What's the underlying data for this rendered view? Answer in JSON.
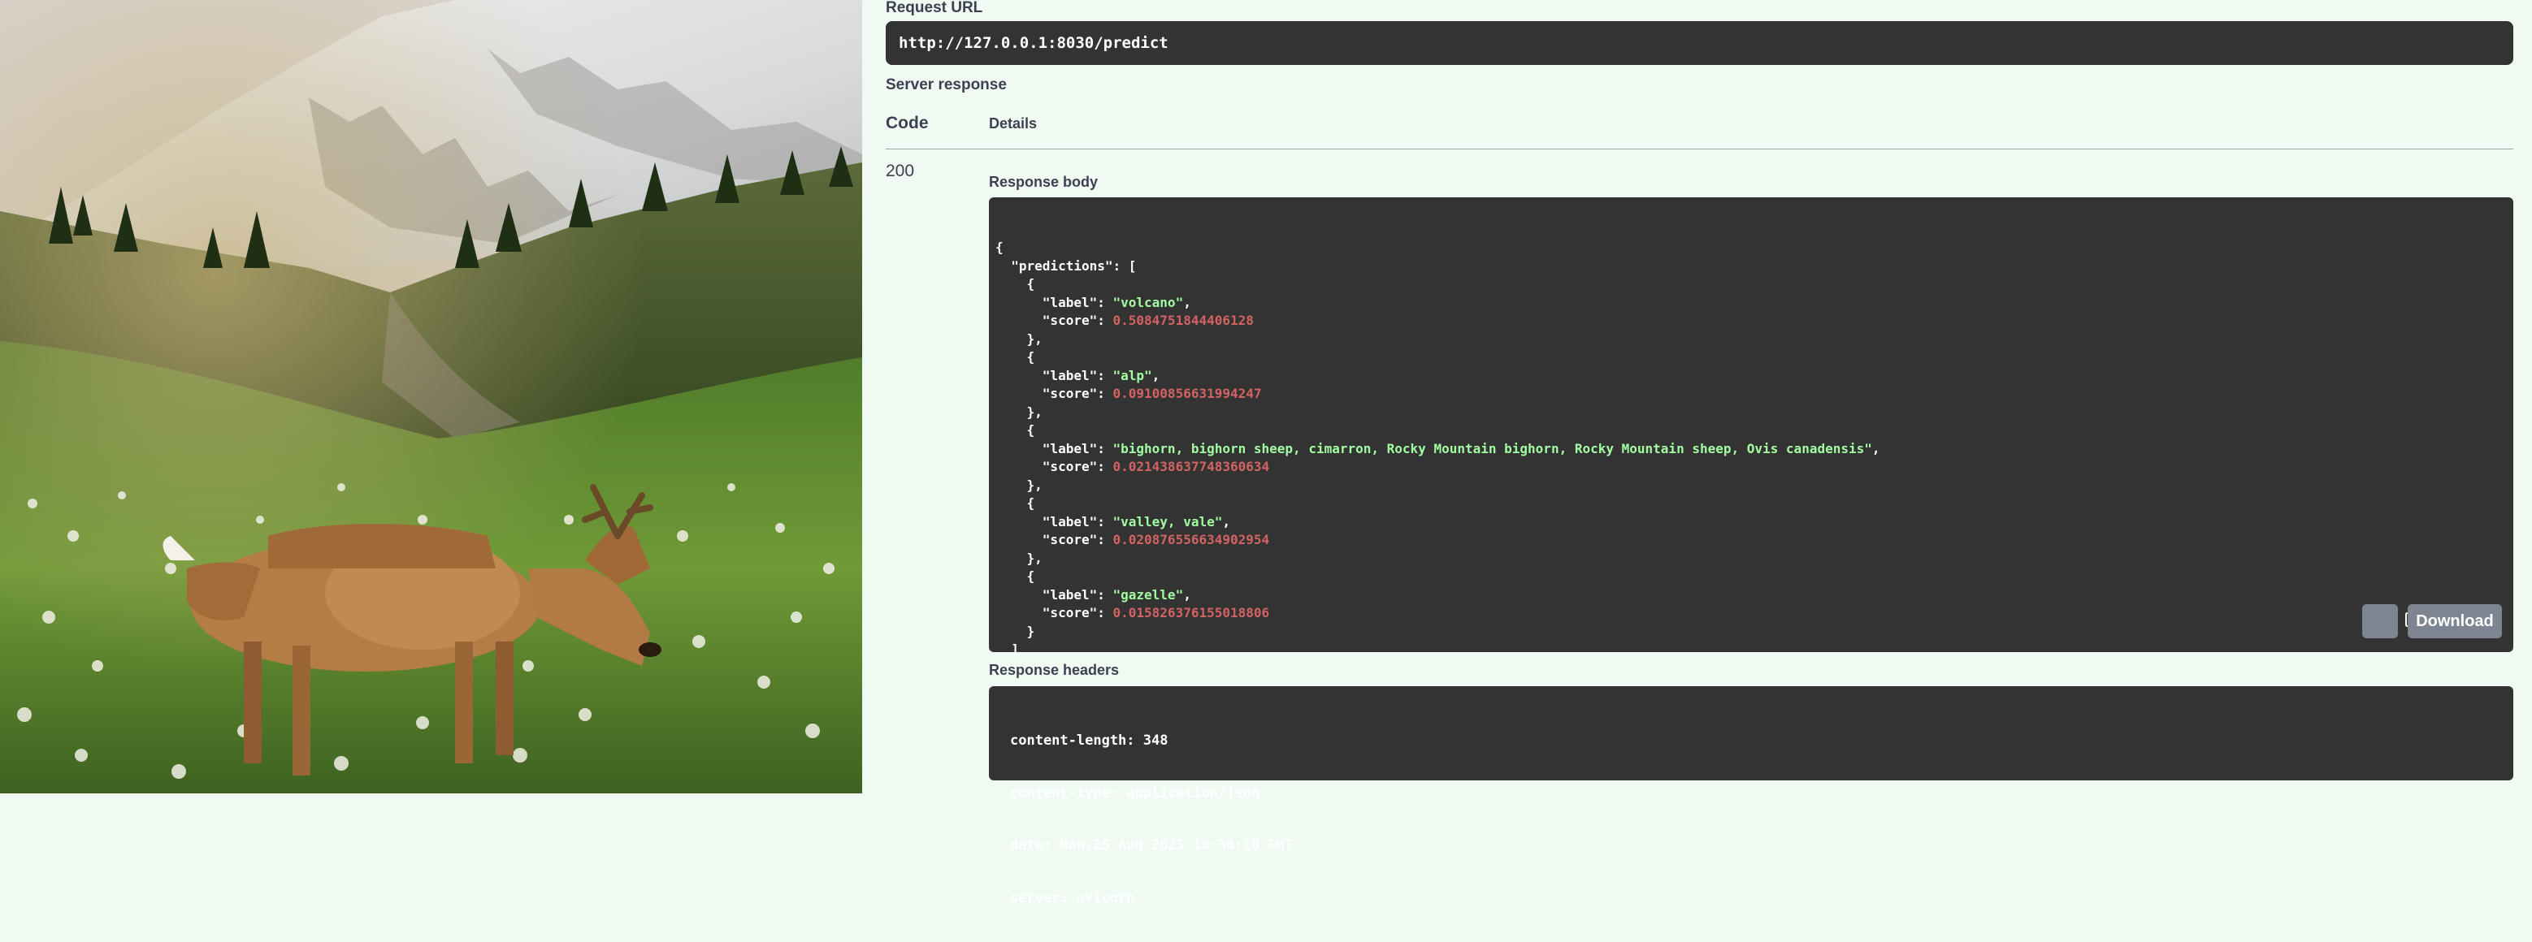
{
  "request_url": {
    "label": "Request URL",
    "value": "http://127.0.0.1:8030/predict"
  },
  "server_response": {
    "label": "Server response",
    "code_header": "Code",
    "details_header": "Details",
    "status_code": "200",
    "response_body_label": "Response body",
    "response_body_lines": [
      {
        "parts": [
          {
            "t": "{",
            "c": "k"
          }
        ]
      },
      {
        "parts": [
          {
            "t": "  \"predictions\": [",
            "c": "k"
          }
        ]
      },
      {
        "parts": [
          {
            "t": "    {",
            "c": "k"
          }
        ]
      },
      {
        "parts": [
          {
            "t": "      \"label\": ",
            "c": "k"
          },
          {
            "t": "\"volcano\"",
            "c": "s"
          },
          {
            "t": ",",
            "c": "k"
          }
        ]
      },
      {
        "parts": [
          {
            "t": "      \"score\": ",
            "c": "k"
          },
          {
            "t": "0.5084751844406128",
            "c": "n"
          }
        ]
      },
      {
        "parts": [
          {
            "t": "    },",
            "c": "k"
          }
        ]
      },
      {
        "parts": [
          {
            "t": "    {",
            "c": "k"
          }
        ]
      },
      {
        "parts": [
          {
            "t": "      \"label\": ",
            "c": "k"
          },
          {
            "t": "\"alp\"",
            "c": "s"
          },
          {
            "t": ",",
            "c": "k"
          }
        ]
      },
      {
        "parts": [
          {
            "t": "      \"score\": ",
            "c": "k"
          },
          {
            "t": "0.09100856631994247",
            "c": "n"
          }
        ]
      },
      {
        "parts": [
          {
            "t": "    },",
            "c": "k"
          }
        ]
      },
      {
        "parts": [
          {
            "t": "    {",
            "c": "k"
          }
        ]
      },
      {
        "parts": [
          {
            "t": "      \"label\": ",
            "c": "k"
          },
          {
            "t": "\"bighorn, bighorn sheep, cimarron, Rocky Mountain bighorn, Rocky Mountain sheep, Ovis canadensis\"",
            "c": "s"
          },
          {
            "t": ",",
            "c": "k"
          }
        ]
      },
      {
        "parts": [
          {
            "t": "      \"score\": ",
            "c": "k"
          },
          {
            "t": "0.021438637748360634",
            "c": "n"
          }
        ]
      },
      {
        "parts": [
          {
            "t": "    },",
            "c": "k"
          }
        ]
      },
      {
        "parts": [
          {
            "t": "    {",
            "c": "k"
          }
        ]
      },
      {
        "parts": [
          {
            "t": "      \"label\": ",
            "c": "k"
          },
          {
            "t": "\"valley, vale\"",
            "c": "s"
          },
          {
            "t": ",",
            "c": "k"
          }
        ]
      },
      {
        "parts": [
          {
            "t": "      \"score\": ",
            "c": "k"
          },
          {
            "t": "0.020876556634902954",
            "c": "n"
          }
        ]
      },
      {
        "parts": [
          {
            "t": "    },",
            "c": "k"
          }
        ]
      },
      {
        "parts": [
          {
            "t": "    {",
            "c": "k"
          }
        ]
      },
      {
        "parts": [
          {
            "t": "      \"label\": ",
            "c": "k"
          },
          {
            "t": "\"gazelle\"",
            "c": "s"
          },
          {
            "t": ",",
            "c": "k"
          }
        ]
      },
      {
        "parts": [
          {
            "t": "      \"score\": ",
            "c": "k"
          },
          {
            "t": "0.015826376155018806",
            "c": "n"
          }
        ]
      },
      {
        "parts": [
          {
            "t": "    }",
            "c": "k"
          }
        ]
      },
      {
        "parts": [
          {
            "t": "  ]",
            "c": "k"
          }
        ]
      },
      {
        "parts": [
          {
            "t": "}",
            "c": "k"
          }
        ]
      }
    ],
    "copy_icon": "clipboard-icon",
    "download_label": "Download",
    "response_headers_label": "Response headers",
    "response_headers": [
      "content-length: 348",
      "content-type: application/json",
      "date: Mon,25 Aug 2025 18:30:10 GMT",
      "server: uvicorn"
    ]
  },
  "colors": {
    "page_background": "#eefaf2",
    "code_background": "#333333",
    "json_string": "#a2fca2",
    "json_number": "#d36363",
    "button_gray": "#7d8492"
  }
}
